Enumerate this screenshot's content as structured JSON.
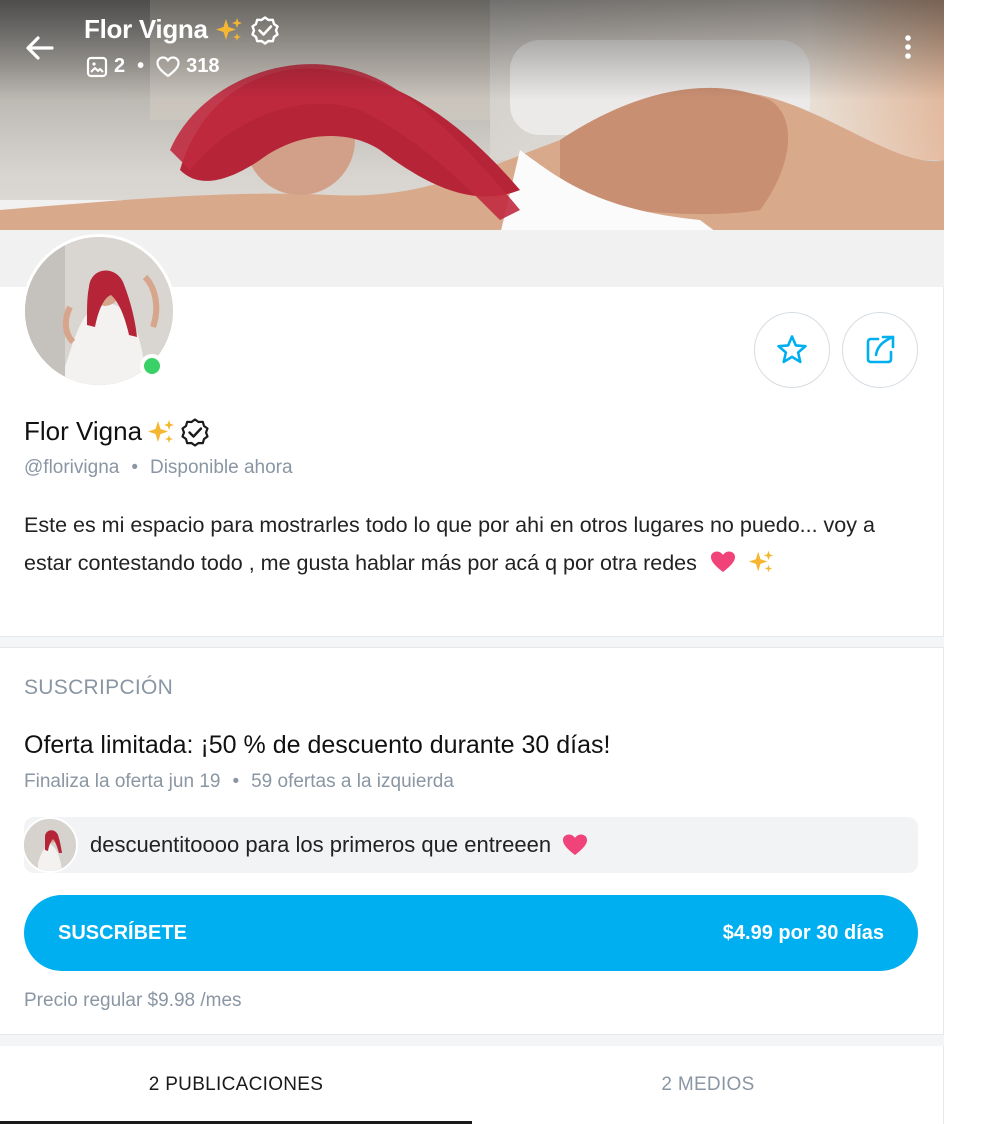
{
  "header": {
    "title": "Flor Vigna",
    "posts_count": "2",
    "likes_count": "318",
    "separator": "•"
  },
  "profile": {
    "name": "Flor Vigna",
    "handle": "@florivigna",
    "status": "Disponible ahora",
    "separator": "•",
    "bio": "Este es mi espacio para mostrarles todo lo que por ahi en otros lugares no puedo... voy a estar contestando todo , me gusta hablar más por acá q por otra redes",
    "online": true
  },
  "subscription": {
    "section_label": "SUSCRIPCIÓN",
    "offer_title": "Oferta limitada: ¡50 % de descuento durante 30 días!",
    "offer_end": "Finaliza la oferta jun 19",
    "offers_left": "59 ofertas a la izquierda",
    "separator": "•",
    "message": "descuentitoooo para los primeros que entreeen",
    "button_label": "SUSCRÍBETE",
    "button_price": "$4.99 por 30 días",
    "regular_price": "Precio regular $9.98 /mes"
  },
  "tabs": [
    {
      "label": "2 PUBLICACIONES",
      "active": true
    },
    {
      "label": "2 MEDIOS",
      "active": false
    }
  ],
  "colors": {
    "accent": "#00aff0",
    "online": "#3ad166",
    "muted_text": "#8a96a3",
    "heart": "#f0437a",
    "sparkle": "#f5b731"
  },
  "icons": [
    "back-arrow-icon",
    "image-icon",
    "heart-icon",
    "sparkles-icon",
    "verified-icon",
    "kebab-menu-icon",
    "star-icon",
    "share-icon",
    "heart-emoji-icon"
  ]
}
